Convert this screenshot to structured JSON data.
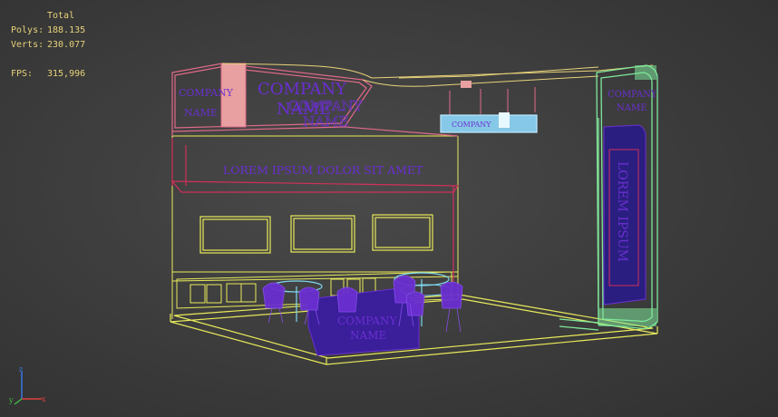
{
  "stats": {
    "header": "Total",
    "polys_label": "Polys:",
    "polys_value": "188.135",
    "verts_label": "Verts:",
    "verts_value": "230.077",
    "fps_label": "FPS:",
    "fps_value": "315,996"
  },
  "scene": {
    "company_name_line1": "COMPANY",
    "company_name_line2": "NAME",
    "banner_text": "LOREM IPSUM DOLOR SIT AMET",
    "side_banner_text": "LOREM IPSUM"
  },
  "gizmo": {
    "x_label": "x",
    "y_label": "y",
    "z_label": "z"
  },
  "colors": {
    "background": "#3e3e3e",
    "stats_text": "#e8d37a",
    "wire_yellow": "#e8ea5a",
    "wire_pink": "#e06a8a",
    "wire_green": "#7fe89a",
    "wire_purple": "#6a2fd0",
    "wire_cyan": "#7fd8f0"
  }
}
